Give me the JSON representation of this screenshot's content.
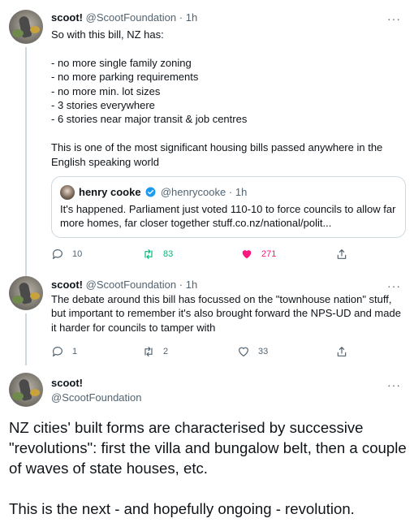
{
  "tweets": [
    {
      "display_name": "scoot!",
      "handle": "@ScootFoundation",
      "dot": "·",
      "time": "1h",
      "text": "So with this bill, NZ has:\n\n- no more single family zoning\n- no more parking requirements\n- no more min. lot sizes\n- 3 stories everywhere\n- 6 stories near major transit & job centres\n\nThis is one of the most significant housing bills passed anywhere in the English speaking world",
      "quote": {
        "display_name": "henry cooke",
        "handle": "@henrycooke",
        "dot": "·",
        "time": "1h",
        "text": "It's happened. Parliament just voted 110-10 to force councils to allow far more homes, far closer together  stuff.co.nz/national/polit..."
      },
      "replies": "10",
      "retweets": "83",
      "likes": "271"
    },
    {
      "display_name": "scoot!",
      "handle": "@ScootFoundation",
      "dot": "·",
      "time": "1h",
      "text": "The debate around this bill has focussed on the \"townhouse nation\" stuff, but important to remember it's also brought forward the NPS-UD and made it harder for councils to tamper with",
      "replies": "1",
      "retweets": "2",
      "likes": "33"
    },
    {
      "display_name": "scoot!",
      "handle": "@ScootFoundation",
      "text": "NZ cities' built forms are characterised by successive \"revolutions\": first the villa and bungalow belt, then a couple of waves of state houses, etc.\n\nThis is the next - and hopefully ongoing - revolution."
    }
  ],
  "more_glyph": "···",
  "colors": {
    "retweet_active": "#00ba7c",
    "like_active": "#f91880",
    "muted": "#536471",
    "verified": "#1d9bf0"
  },
  "icons": [
    "reply-icon",
    "retweet-icon",
    "like-icon",
    "share-icon",
    "more-icon",
    "verified-badge-icon"
  ]
}
